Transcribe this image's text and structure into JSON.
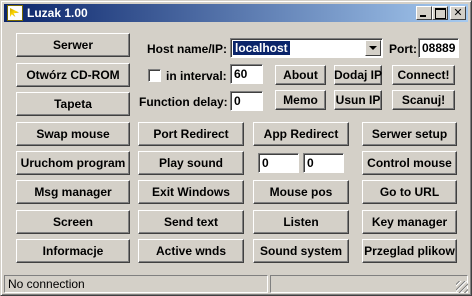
{
  "window": {
    "title": "Luzak 1.00"
  },
  "connection": {
    "host_label": "Host name/IP:",
    "host_value": "localhost",
    "port_label": "Port:",
    "port_value": "08889",
    "interval_label": "in interval:",
    "interval_value": "60",
    "delay_label": "Function delay:",
    "delay_value": "0"
  },
  "left_buttons": [
    "Serwer",
    "Otwórz CD-ROM",
    "Tapeta",
    "Swap mouse",
    "Uruchom program",
    "Msg manager",
    "Screen",
    "Informacje"
  ],
  "top_buttons": {
    "about": "About",
    "add_ip": "Dodaj IP",
    "connect": "Connect!",
    "memo": "Memo",
    "remove_ip": "Usun IP",
    "scan": "Scanuj!"
  },
  "grid_buttons": {
    "port_redirect": "Port Redirect",
    "app_redirect": "App Redirect",
    "server_setup": "Serwer setup",
    "play_sound": "Play sound",
    "control_mouse": "Control mouse",
    "exit_windows": "Exit Windows",
    "mouse_pos": "Mouse pos",
    "go_to_url": "Go to URL",
    "send_text": "Send text",
    "listen": "Listen",
    "key_manager": "Key manager",
    "active_wnds": "Active wnds",
    "sound_system": "Sound system",
    "file_browser": "Przeglad plikow"
  },
  "mouse_fields": {
    "x": "0",
    "y": "0"
  },
  "status": {
    "text": "No connection"
  }
}
